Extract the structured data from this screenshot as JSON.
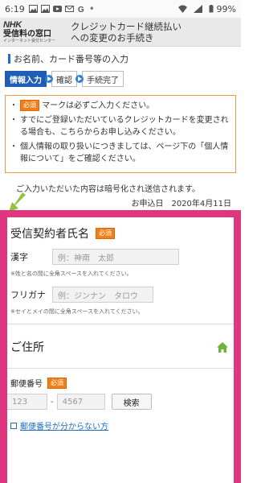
{
  "status_bar": {
    "time": "6:19",
    "battery": "99%"
  },
  "header": {
    "logo_nhk": "NHK",
    "logo_main": "受信料の窓口",
    "logo_sub": "インターネット受付センター",
    "title": "クレジットカード継続払い\nへの変更のお手続き"
  },
  "section": {
    "label": "お名前、カード番号等の入力"
  },
  "steps": [
    "情報入力",
    "確認",
    "手続完了"
  ],
  "notice": {
    "required_badge": "必須",
    "item1_suffix": "マークは必ずご入力ください。",
    "item2": "すでにご登録いただいているクレジットカードを変更される場合も、こちらからお申し込みください。",
    "item3": "個人情報の取り扱いにつきましては、ページ下の「個人情報について」をご確認ください。"
  },
  "encrypt_note": "ご入力いただいた内容は暗号化され送信されます。",
  "date": "お申込日　2020年4月11日",
  "form": {
    "name_title": "受信契約者氏名",
    "required_badge": "必須",
    "kanji_label": "漢字",
    "kanji_placeholder": "例：神南　太郎",
    "kanji_hint": "※姓と名の間に全角スペースを入れてください。",
    "furigana_label": "フリガナ",
    "furigana_placeholder": "例：ジンナン　タロウ",
    "furigana_hint": "※セイとメイの間に全角スペースを入れてください。",
    "address_title": "ご住所",
    "zip_label": "郵便番号",
    "zip1_placeholder": "123",
    "zip_dash": "-",
    "zip2_placeholder": "4567",
    "search_button": "検索",
    "zip_link": "郵便番号が分からない方"
  }
}
